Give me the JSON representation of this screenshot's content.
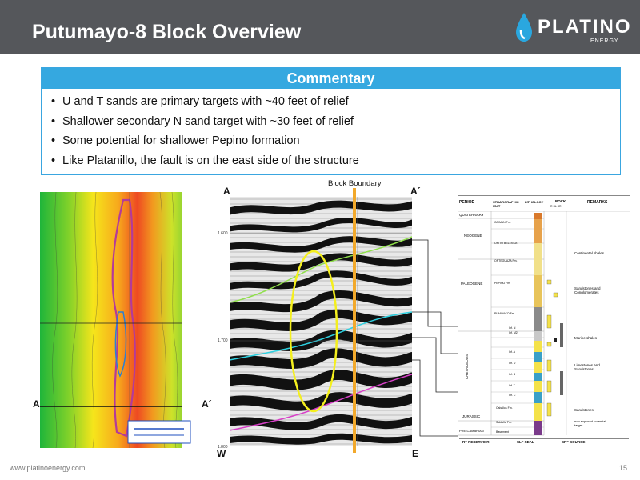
{
  "header": {
    "title": "Putumayo-8 Block Overview",
    "logo_word": "PLATINO",
    "logo_sub": "ENERGY"
  },
  "commentary": {
    "title": "Commentary",
    "items": [
      "U and T sands are primary targets with ~40 feet of relief",
      "Shallower secondary N sand target with ~30 feet of relief",
      "Some potential for shallower Pepino formation",
      "Like Platanillo, the fault is on the east side of the structure"
    ]
  },
  "map": {
    "label_a": "A",
    "label_a_prime": "A´"
  },
  "seismic": {
    "block_boundary": "Block Boundary",
    "label_a": "A",
    "label_a_prime": "A´",
    "label_w": "W",
    "label_e": "E",
    "ticks": [
      "1.600",
      "1.700",
      "1.800"
    ]
  },
  "strat": {
    "head_period": "PERIOD",
    "head_unit": "STRATIGRAPHIC UNIT",
    "head_lith": "LITHOLOGY",
    "head_rock": "ROCK",
    "head_rock_sub": "R   SL   SR",
    "head_remarks": "REMARKS",
    "periods": [
      "QUATERNARY",
      "NEOGENE",
      "PALEOGENE",
      "CRETACEOUS",
      "JURASSIC",
      "PRE-CAMBRIAN"
    ],
    "units": [
      "CAIMAN Fm.",
      "ORITO BELEN Gr.",
      "ORTEGUAZA Fm.",
      "PEPINO Fm.",
      "RUMIYACO Fm.",
      "Inf. N",
      "Inf. M2",
      "Inf. A",
      "Inf. U",
      "Inf. B",
      "Inf. T",
      "Inf. C",
      "Caballos Fm.",
      "Saldaña Fm.",
      "Basement"
    ],
    "remarks": [
      "Continental shales",
      "Sandstones and Conglomerates",
      "Marine shales",
      "Limestones and Sandstones",
      "Sandstones",
      "non explored potential target"
    ],
    "legend": [
      "R= RESERVOIR",
      "SL= SEAL",
      "SR= SOURCE"
    ]
  },
  "footer": {
    "url": "www.platinoenergy.com",
    "page": "15"
  },
  "colors": {
    "header_bg": "#55575b",
    "accent_blue": "#35a8e0",
    "boundary_orange": "#f2a92c",
    "ellipse_yellow": "#f4ef1e"
  }
}
